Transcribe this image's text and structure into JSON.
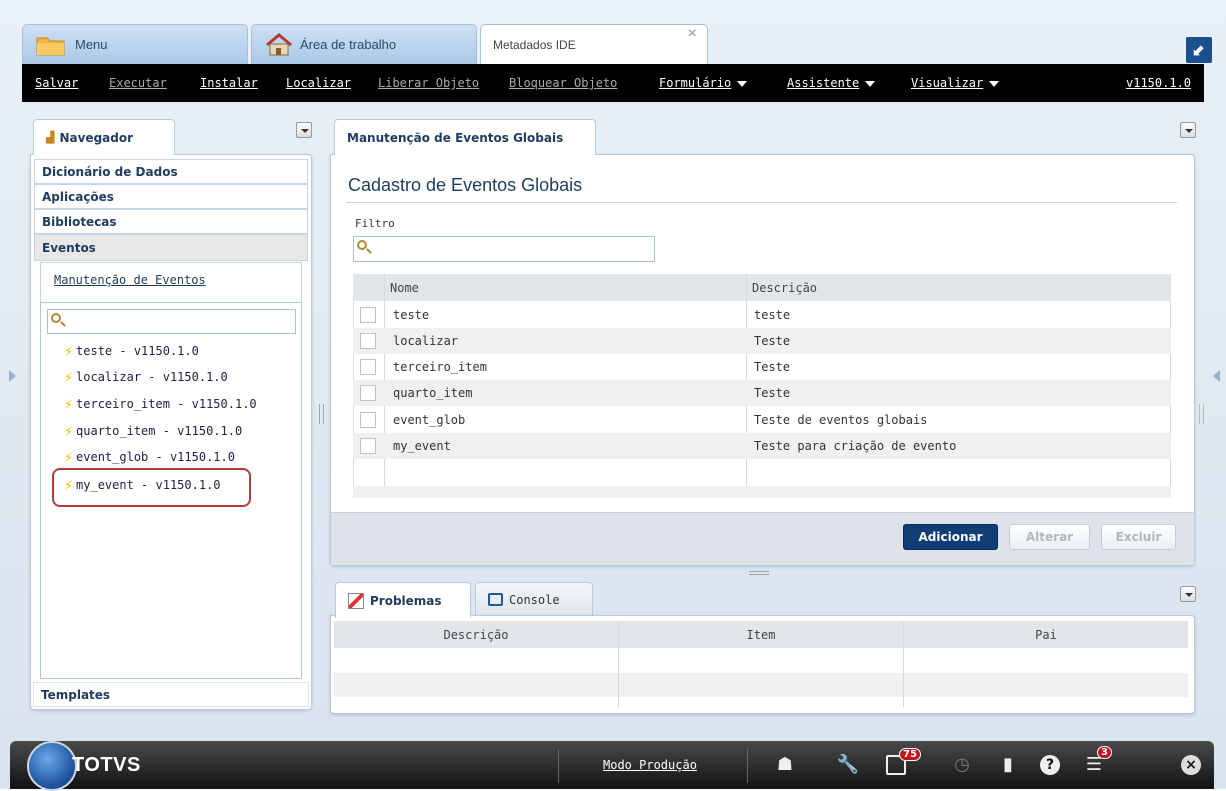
{
  "top_tabs": [
    {
      "label": "Menu"
    },
    {
      "label": "Área de trabalho"
    },
    {
      "label": "Metadados IDE"
    }
  ],
  "menubar": {
    "items": [
      {
        "label": "Salvar",
        "enabled": true
      },
      {
        "label": "Executar",
        "enabled": false
      },
      {
        "label": "Instalar",
        "enabled": true
      },
      {
        "label": "Localizar",
        "enabled": true
      },
      {
        "label": "Liberar Objeto",
        "enabled": false
      },
      {
        "label": "Bloquear Objeto",
        "enabled": false
      },
      {
        "label": "Formulário",
        "enabled": true
      },
      {
        "label": "Assistente",
        "enabled": true
      },
      {
        "label": "Visualizar",
        "enabled": true
      }
    ],
    "version": "v1150.1.0"
  },
  "navigator": {
    "tab_label": "Navegador",
    "sections": [
      "Dicionário de Dados",
      "Aplicações",
      "Bibliotecas",
      "Eventos"
    ],
    "link": "Manutenção de Eventos",
    "tree_items": [
      "teste - v1150.1.0",
      "localizar - v1150.1.0",
      "terceiro_item - v1150.1.0",
      "quarto_item - v1150.1.0",
      "event_glob - v1150.1.0",
      "my_event - v1150.1.0"
    ],
    "bottom_section": "Templates"
  },
  "main": {
    "tab_label": "Manutenção de Eventos Globais",
    "title": "Cadastro de Eventos Globais",
    "filter_label": "Filtro",
    "columns": [
      "Nome",
      "Descrição"
    ],
    "rows": [
      {
        "nome": "teste",
        "descricao": "teste"
      },
      {
        "nome": "localizar",
        "descricao": "Teste"
      },
      {
        "nome": "terceiro_item",
        "descricao": "Teste"
      },
      {
        "nome": "quarto_item",
        "descricao": "Teste"
      },
      {
        "nome": "event_glob",
        "descricao": "Teste de eventos globais"
      },
      {
        "nome": "my_event",
        "descricao": "Teste para criação de evento"
      }
    ],
    "buttons": {
      "add": "Adicionar",
      "edit": "Alterar",
      "delete": "Excluir"
    }
  },
  "bottom_panel": {
    "tabs": [
      "Problemas",
      "Console"
    ],
    "columns": [
      "Descrição",
      "Item",
      "Pai"
    ]
  },
  "taskbar": {
    "brand": "TOTVS",
    "mode": "Modo Produção",
    "notifications_count": "75",
    "messages_count": "3"
  },
  "colors": {
    "accent": "#103d75",
    "highlight_border": "#b23a3a",
    "menubar_bg": "#000000"
  }
}
